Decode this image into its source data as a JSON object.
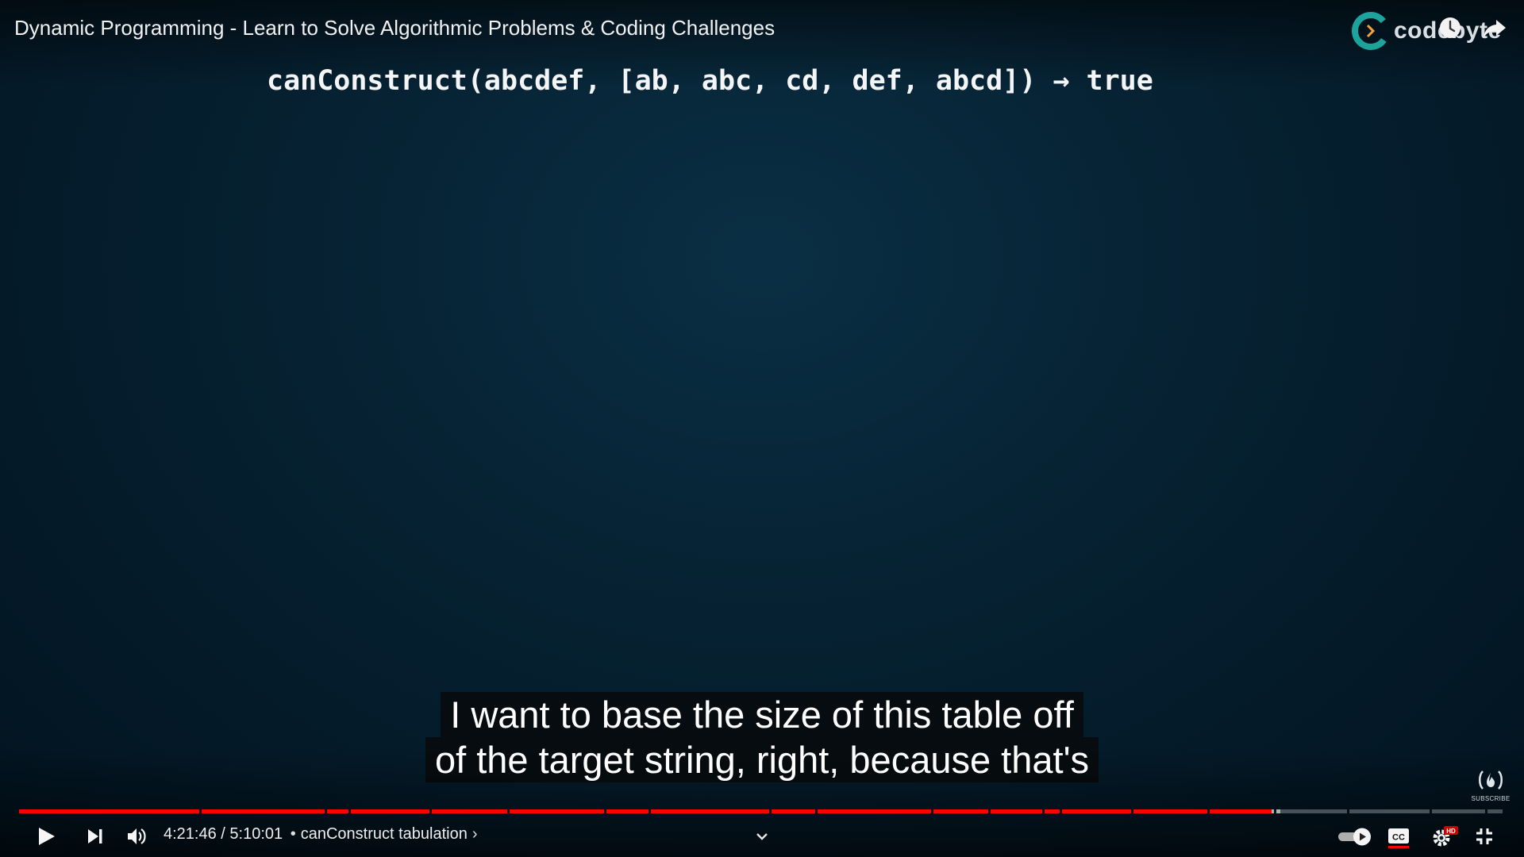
{
  "video": {
    "title": "Dynamic Programming - Learn to Solve Algorithmic Problems & Coding Challenges",
    "slide_text": "canConstruct(abcdef, [ab, abc, cd, def, abcd]) → true",
    "watermark": "codebyte",
    "channel_badge_text": "SUBSCRIBE"
  },
  "captions": {
    "line1": "I want to base the size of this table off",
    "line2": "of the target string, right, because that's"
  },
  "player": {
    "current_time": "4:21:46",
    "separator": "/",
    "duration": "5:10:01",
    "chapter_bullet": "•",
    "chapter_title": "canConstruct tabulation",
    "chapter_chevron": "›",
    "progress_fraction": 0.843,
    "buffered_fraction": 0.849,
    "colors": {
      "progress": "#ff0000",
      "background": "#011522",
      "hd_badge": "#cc0000"
    }
  },
  "icons": {
    "play": "play-icon",
    "next": "skip-next-icon",
    "volume": "volume-icon",
    "chapters": "chevron-down-icon",
    "autoplay": "autoplay-toggle-icon",
    "captions": "closed-captions-icon",
    "settings": "settings-gear-icon",
    "exit_fullscreen": "exit-fullscreen-icon",
    "watch_later": "clock-icon",
    "share": "share-arrow-icon"
  }
}
